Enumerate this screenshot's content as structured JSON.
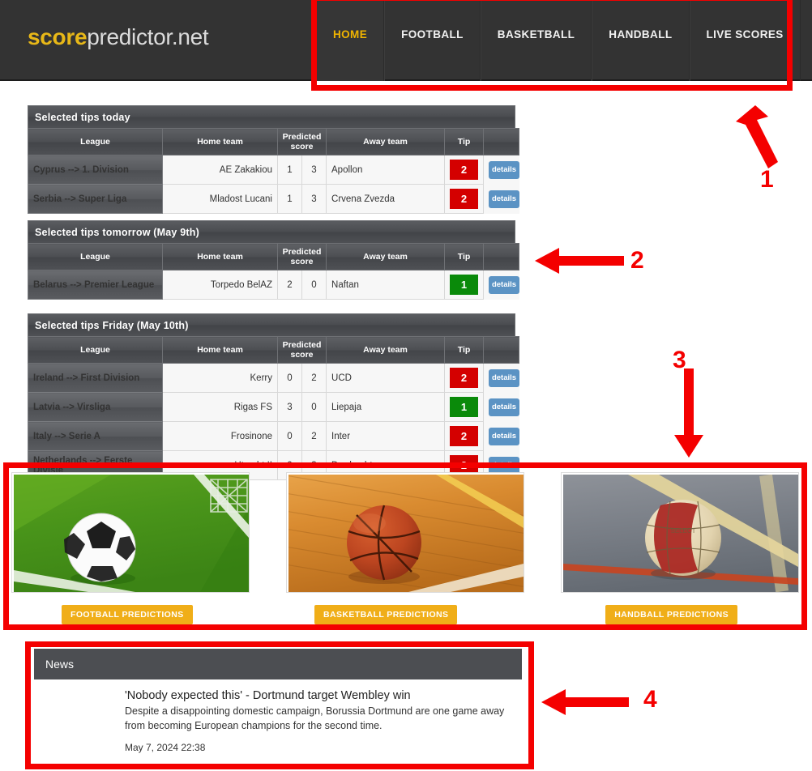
{
  "header": {
    "logo_primary": "score",
    "logo_secondary": "predictor.net",
    "nav": [
      {
        "label": "HOME",
        "active": true
      },
      {
        "label": "FOOTBALL",
        "active": false
      },
      {
        "label": "BASKETBALL",
        "active": false
      },
      {
        "label": "HANDBALL",
        "active": false
      },
      {
        "label": "LIVE SCORES",
        "active": false
      }
    ]
  },
  "columns": {
    "league": "League",
    "home": "Home team",
    "predicted": "Predicted score",
    "away": "Away team",
    "tip": "Tip",
    "details": ""
  },
  "details_label": "details",
  "colors": {
    "tip_away_win": "#d40000",
    "tip_home_win": "#0a8a0a",
    "details_button": "#5b93c4",
    "promo_button": "#f0ae18",
    "logo_accent": "#e8b818",
    "annotation": "#f40000"
  },
  "tables": [
    {
      "title": "Selected tips today",
      "rows": [
        {
          "league": "Cyprus --> 1. Division",
          "home": "AE Zakakiou",
          "home_score": "1",
          "away_score": "3",
          "away": "Apollon",
          "tip": "2",
          "tip_kind": "away"
        },
        {
          "league": "Serbia --> Super Liga",
          "home": "Mladost Lucani",
          "home_score": "1",
          "away_score": "3",
          "away": "Crvena Zvezda",
          "tip": "2",
          "tip_kind": "away"
        }
      ]
    },
    {
      "title": "Selected tips tomorrow (May 9th)",
      "rows": [
        {
          "league": "Belarus --> Premier League",
          "home": "Torpedo BelAZ",
          "home_score": "2",
          "away_score": "0",
          "away": "Naftan",
          "tip": "1",
          "tip_kind": "home"
        }
      ]
    },
    {
      "title": "Selected tips Friday (May 10th)",
      "rows": [
        {
          "league": "Ireland --> First Division",
          "home": "Kerry",
          "home_score": "0",
          "away_score": "2",
          "away": "UCD",
          "tip": "2",
          "tip_kind": "away"
        },
        {
          "league": "Latvia --> Virsliga",
          "home": "Rigas FS",
          "home_score": "3",
          "away_score": "0",
          "away": "Liepaja",
          "tip": "1",
          "tip_kind": "home"
        },
        {
          "league": "Italy --> Serie A",
          "home": "Frosinone",
          "home_score": "0",
          "away_score": "2",
          "away": "Inter",
          "tip": "2",
          "tip_kind": "away"
        },
        {
          "league": "Netherlands --> Eerste Divisie",
          "home": "Utrecht II",
          "home_score": "0",
          "away_score": "3",
          "away": "Dordrecht",
          "tip": "2",
          "tip_kind": "away"
        }
      ]
    }
  ],
  "promos": [
    {
      "image": "football-pitch-with-soccer-ball",
      "button": "FOOTBALL PREDICTIONS"
    },
    {
      "image": "basketball-court-with-basketball",
      "button": "BASKETBALL PREDICTIONS"
    },
    {
      "image": "handball-court-with-handball",
      "button": "HANDBALL PREDICTIONS"
    }
  ],
  "news": {
    "section_title": "News",
    "headline": "'Nobody expected this' - Dortmund target Wembley win",
    "summary": "Despite a disappointing domestic campaign, Borussia Dortmund are one game away from becoming European champions for the second time.",
    "date": "May 7, 2024 22:38"
  },
  "annotations": [
    {
      "number": "1",
      "target": "main-navigation"
    },
    {
      "number": "2",
      "target": "selected-tips-tomorrow-table"
    },
    {
      "number": "3",
      "target": "sport-prediction-promos"
    },
    {
      "number": "4",
      "target": "news-section"
    }
  ]
}
